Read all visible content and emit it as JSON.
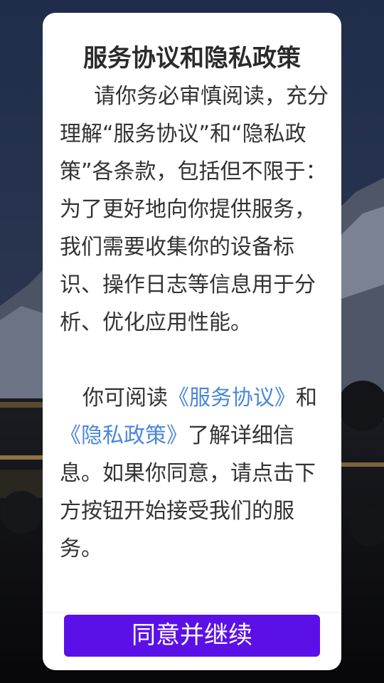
{
  "dialog": {
    "title": "服务协议和隐私政策",
    "para1": "请你务必审慎阅读，充分理解“服务协议”和“隐私政策”各条款，包括但不限于：为了更好地向你提供服务，我们需要收集你的设备标识、操作日志等信息用于分析、优化应用性能。",
    "para2_lead": "你可阅读",
    "link_service": "《服务协议》",
    "para2_and": "和",
    "link_privacy": "《隐私政策》",
    "para2_tail": "了解详细信息。如果你同意，请点击下方按钮开始接受我们的服务。",
    "agree_button": "同意并继续"
  },
  "colors": {
    "accent_button": "#5c10e8",
    "link": "#4a86d9",
    "text": "#333333"
  }
}
